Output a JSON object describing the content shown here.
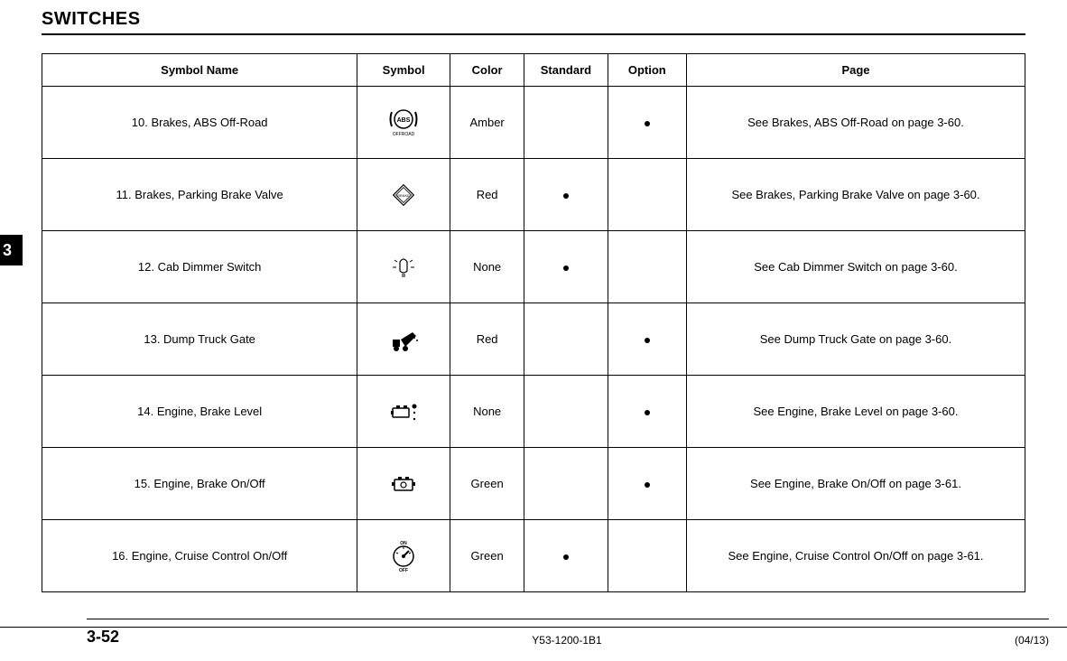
{
  "chapter_tab": "3",
  "section_title": "SWITCHES",
  "table": {
    "headers": {
      "symbol_name": "Symbol Name",
      "symbol": "Symbol",
      "color": "Color",
      "standard": "Standard",
      "option": "Option",
      "page": "Page"
    },
    "rows": [
      {
        "num": "10.",
        "name": "Brakes, ABS Off-Road",
        "icon": "abs-offroad-icon",
        "color": "Amber",
        "standard": false,
        "option": true,
        "page_ref": "See Brakes, ABS Off-Road on page 3-60."
      },
      {
        "num": "11.",
        "name": "Brakes, Parking Brake Valve",
        "icon": "parking-brake-valve-icon",
        "color": "Red",
        "standard": true,
        "option": false,
        "page_ref": "See Brakes, Parking Brake Valve on page 3-60."
      },
      {
        "num": "12.",
        "name": "Cab Dimmer Switch",
        "icon": "cab-dimmer-icon",
        "color": "None",
        "standard": true,
        "option": false,
        "page_ref": "See Cab Dimmer Switch on page 3-60."
      },
      {
        "num": "13.",
        "name": "Dump Truck Gate",
        "icon": "dump-truck-icon",
        "color": "Red",
        "standard": false,
        "option": true,
        "page_ref": "See Dump Truck Gate on page 3-60."
      },
      {
        "num": "14.",
        "name": "Engine, Brake Level",
        "icon": "engine-brake-level-icon",
        "color": "None",
        "standard": false,
        "option": true,
        "page_ref": "See Engine, Brake Level on page 3-60."
      },
      {
        "num": "15.",
        "name": "Engine, Brake On/Off",
        "icon": "engine-brake-onoff-icon",
        "color": "Green",
        "standard": false,
        "option": true,
        "page_ref": "See Engine, Brake On/Off on page 3-61."
      },
      {
        "num": "16.",
        "name": "Engine, Cruise Control On/Off",
        "icon": "cruise-control-icon",
        "color": "Green",
        "standard": true,
        "option": false,
        "page_ref": "See Engine, Cruise Control On/Off on page 3-61."
      }
    ]
  },
  "footer": {
    "page_number": "3-52",
    "doc_id": "Y53-1200-1B1",
    "date": "(04/13)"
  }
}
